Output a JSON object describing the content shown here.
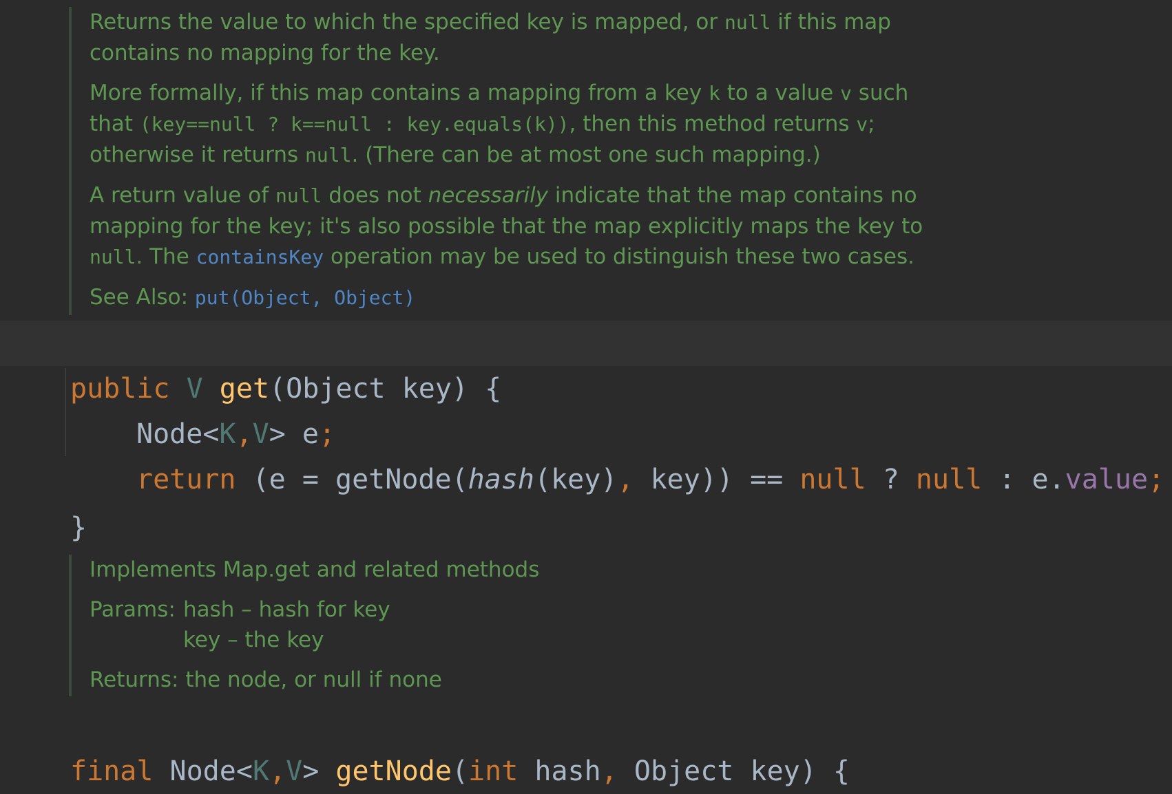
{
  "doc1": {
    "p1": {
      "a": "Returns the value to which the specified key is mapped, or ",
      "c1": "null",
      "b": " if this map contains no mapping for the key."
    },
    "p2": {
      "a": "More formally, if this map contains a mapping from a key ",
      "c1": "k",
      "b": " to a value ",
      "c2": "v",
      "c": " such that ",
      "c3": "(key==null ? k==null : key.equals(k))",
      "d": ", then this method returns ",
      "c4": "v",
      "e": "; otherwise it returns ",
      "c5": "null",
      "f": ". (There can be at most one such mapping.)"
    },
    "p3": {
      "a": "A return value of ",
      "c1": "null",
      "b": " does not ",
      "em": "necessarily",
      "c": " indicate that the map contains no mapping for the key; it's also possible that the map explicitly maps the key to ",
      "c2": "null",
      "d": ". The ",
      "link": "containsKey",
      "e": " operation may be used to distinguish these two cases."
    },
    "see_also_label": "See Also: ",
    "see_also_link": "put(Object, Object)"
  },
  "code1": {
    "line1": {
      "kw": "public",
      "type": "V",
      "fn": "get",
      "rest": "(Object key) {"
    },
    "line2": {
      "a": "Node<",
      "k": "K",
      "comma": ",",
      "v": "V",
      "b": "> e",
      "semi": ";"
    },
    "line3": {
      "kw": "return",
      "a": " (e = getNode(",
      "hash": "hash",
      "b": "(key)",
      "comma": ",",
      "c": " key)) == ",
      "null1": "null",
      "d": " ? ",
      "null2": "null",
      "e": " : e.",
      "field": "value",
      "semi": ";"
    },
    "line4": "}"
  },
  "doc2": {
    "summary": "Implements Map.get and related methods",
    "params_label": "Params:",
    "param1": "hash – hash for key",
    "param2": "key – the key",
    "returns_label": "Returns:",
    "returns": "the node, or null if none"
  },
  "code2": {
    "kw": "final",
    "a": "Node<",
    "k": "K",
    "comma": ",",
    "v": "V",
    "b": "> ",
    "fn": "getNode",
    "c": "(",
    "int": "int",
    "d": " hash",
    "comma2": ",",
    "e": " Object key) {"
  }
}
